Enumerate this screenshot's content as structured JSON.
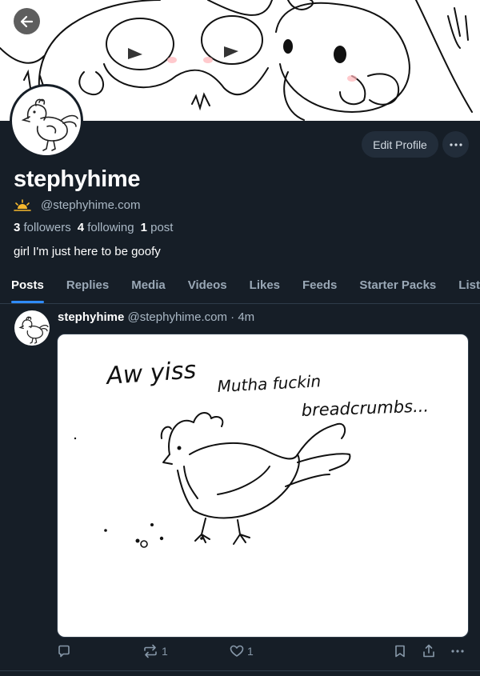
{
  "profile": {
    "display_name": "stephyhime",
    "handle": "@stephyhime.com",
    "handle_emoji": "sun-horizon-icon",
    "followers_count": "3",
    "followers_label": "followers",
    "following_count": "4",
    "following_label": "following",
    "posts_count": "1",
    "posts_label": "post",
    "bio": "girl I'm just here to be goofy",
    "edit_label": "Edit Profile"
  },
  "tabs": [
    "Posts",
    "Replies",
    "Media",
    "Videos",
    "Likes",
    "Feeds",
    "Starter Packs",
    "Lists"
  ],
  "active_tab": "Posts",
  "post": {
    "author": "stephyhime",
    "handle": "@stephyhime.com",
    "separator": "·",
    "time": "4m",
    "image_text": {
      "line1": "Aw yiss",
      "line2": "Mutha fuckin",
      "line3": "breadcrumbs..."
    },
    "reply_count": "",
    "repost_count": "1",
    "like_count": "1"
  },
  "colors": {
    "background": "#161e27",
    "accent": "#2f8cff",
    "muted_text": "#aab8c5",
    "button_bg": "#222d3a"
  }
}
